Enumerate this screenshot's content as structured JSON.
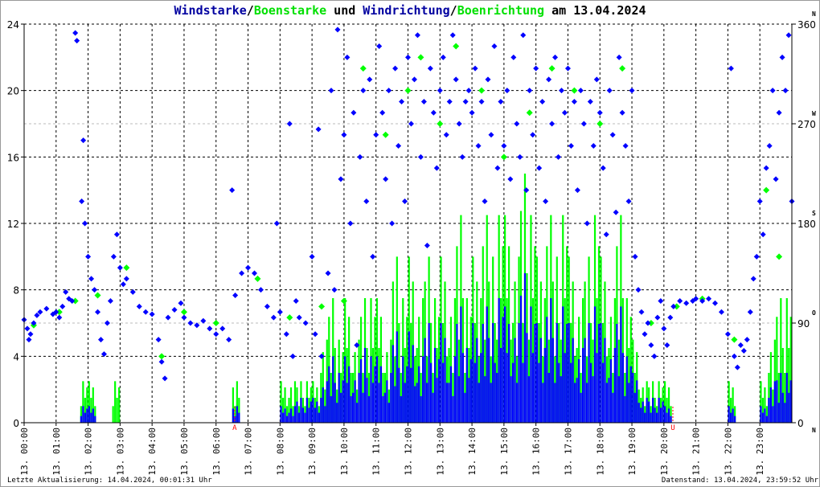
{
  "title": {
    "p1": "Windstarke",
    "s1": "/",
    "p2": "Boenstarke",
    "p3": " und ",
    "p4": "Windrichtung",
    "s2": "/",
    "p5": "Boenrichtung",
    "p6": " am 13.04.2024"
  },
  "footer": {
    "left": "Letzte Aktualisierung: 14.04.2024, 00:01:31 Uhr",
    "right": "Datenstand: 13.04.2024, 23:59:52 Uhr"
  },
  "chart_data": {
    "type": "scatter",
    "title": "Windstarke/Boenstarke und Windrichtung/Boenrichtung am 13.04.2024",
    "x_range_hours": [
      0,
      24
    ],
    "x_tick_labels": [
      "13. 00:00",
      "13. 01:00",
      "13. 02:00",
      "13. 03:00",
      "13. 04:00",
      "13. 05:00",
      "13. 06:00",
      "13. 07:00",
      "13. 08:00",
      "13. 09:00",
      "13. 10:00",
      "13. 11:00",
      "13. 12:00",
      "13. 13:00",
      "13. 14:00",
      "13. 15:00",
      "13. 16:00",
      "13. 17:00",
      "13. 18:00",
      "13. 19:00",
      "13. 20:00",
      "13. 21:00",
      "13. 22:00",
      "13. 23:00"
    ],
    "left_axis": {
      "range": [
        0,
        24
      ],
      "ticks": [
        "0",
        "4",
        "8",
        "12",
        "16",
        "20",
        "24"
      ]
    },
    "right_axis": {
      "range": [
        0,
        360
      ],
      "ticks": [
        "0",
        "90",
        "180",
        "270",
        "360"
      ],
      "compass": [
        "N",
        "O",
        "S",
        "W",
        "N"
      ]
    },
    "markers": [
      {
        "label": "A",
        "hour": 6.58
      },
      {
        "label": "U",
        "hour": 20.28
      }
    ],
    "colors": {
      "wind": "#0000ff",
      "gust": "#00ff00",
      "marker": "#ff0000"
    },
    "interval_minutes": 15,
    "gust_speed": [
      0,
      0,
      0,
      0,
      0,
      0,
      0,
      2.5,
      2.5,
      0,
      0,
      2.5,
      0,
      0,
      0,
      0,
      0,
      0,
      0,
      0,
      0,
      0,
      0,
      0,
      0,
      0,
      2.5,
      0,
      0,
      0,
      0,
      0,
      2.5,
      2.5,
      2.5,
      2.5,
      2.5,
      5,
      7.5,
      5,
      7.5,
      5,
      7.5,
      7.5,
      7.5,
      5,
      10,
      7.5,
      10,
      7.5,
      10,
      7.5,
      10,
      7.5,
      12.5,
      7.5,
      10,
      12.5,
      10,
      12.5,
      12.5,
      10,
      15,
      12.5,
      10,
      12.5,
      10,
      12.5,
      10,
      7.5,
      10,
      12.5,
      10,
      7.5,
      12.5,
      7.5,
      5,
      2.5,
      2.5,
      2.5,
      2.5,
      0,
      0,
      0,
      0,
      0,
      0,
      0,
      2.5,
      0,
      0,
      0,
      2.5,
      5,
      7.5,
      7.5
    ],
    "wind_speed": [
      0,
      0,
      0,
      0,
      0,
      0,
      0,
      1,
      1,
      0,
      0,
      0,
      0,
      0,
      0,
      0,
      0,
      0,
      0,
      0,
      0,
      0,
      0,
      0,
      0,
      0,
      1,
      0,
      0,
      0,
      0,
      0,
      1,
      1,
      1.5,
      1.5,
      1.5,
      2.5,
      4,
      3,
      4,
      3,
      4.5,
      4,
      4,
      3,
      5.5,
      4,
      5.5,
      4,
      6,
      4.5,
      6,
      4,
      7,
      4.5,
      6,
      7,
      6,
      7.5,
      7,
      6,
      9,
      7,
      6,
      7.5,
      6,
      7,
      6,
      4.5,
      6,
      7,
      6,
      4.5,
      7,
      4,
      3,
      1.5,
      1.5,
      1.5,
      1,
      0,
      0,
      0,
      0,
      0,
      0,
      0,
      1,
      0,
      0,
      0,
      1,
      2.5,
      3,
      3
    ],
    "wind_direction": [
      [
        0,
        93
      ],
      [
        0.1,
        85
      ],
      [
        0.15,
        75
      ],
      [
        0.2,
        80
      ],
      [
        0.3,
        90
      ],
      [
        0.4,
        97
      ],
      [
        0.5,
        100
      ],
      [
        0.7,
        103
      ],
      [
        0.9,
        98
      ],
      [
        1,
        100
      ],
      [
        1.1,
        95
      ],
      [
        1.2,
        105
      ],
      [
        1.3,
        118
      ],
      [
        1.4,
        112
      ],
      [
        1.5,
        110
      ],
      [
        1.6,
        352
      ],
      [
        1.65,
        345
      ],
      [
        1.8,
        200
      ],
      [
        1.85,
        255
      ],
      [
        1.9,
        180
      ],
      [
        2,
        150
      ],
      [
        2.1,
        130
      ],
      [
        2.2,
        120
      ],
      [
        2.3,
        100
      ],
      [
        2.4,
        75
      ],
      [
        2.5,
        62
      ],
      [
        2.6,
        90
      ],
      [
        2.7,
        110
      ],
      [
        2.8,
        150
      ],
      [
        2.9,
        170
      ],
      [
        3,
        140
      ],
      [
        3.1,
        125
      ],
      [
        3.2,
        130
      ],
      [
        3.4,
        118
      ],
      [
        3.6,
        105
      ],
      [
        3.8,
        100
      ],
      [
        4,
        98
      ],
      [
        4.2,
        75
      ],
      [
        4.3,
        55
      ],
      [
        4.4,
        40
      ],
      [
        4.5,
        95
      ],
      [
        4.7,
        102
      ],
      [
        4.9,
        108
      ],
      [
        5,
        95
      ],
      [
        5.2,
        90
      ],
      [
        5.4,
        88
      ],
      [
        5.6,
        92
      ],
      [
        5.8,
        85
      ],
      [
        6,
        80
      ],
      [
        6.2,
        85
      ],
      [
        6.4,
        75
      ],
      [
        6.5,
        210
      ],
      [
        6.6,
        115
      ],
      [
        6.8,
        135
      ],
      [
        7,
        140
      ],
      [
        7.2,
        135
      ],
      [
        7.4,
        120
      ],
      [
        7.6,
        105
      ],
      [
        7.8,
        95
      ],
      [
        7.9,
        180
      ],
      [
        8,
        100
      ],
      [
        8.2,
        80
      ],
      [
        8.3,
        270
      ],
      [
        8.4,
        60
      ],
      [
        8.5,
        110
      ],
      [
        8.6,
        95
      ],
      [
        8.8,
        90
      ],
      [
        9,
        150
      ],
      [
        9.1,
        80
      ],
      [
        9.2,
        265
      ],
      [
        9.3,
        60
      ],
      [
        9.5,
        135
      ],
      [
        9.6,
        300
      ],
      [
        9.7,
        120
      ],
      [
        9.8,
        355
      ],
      [
        9.9,
        220
      ],
      [
        10,
        260
      ],
      [
        10.1,
        330
      ],
      [
        10.2,
        180
      ],
      [
        10.3,
        280
      ],
      [
        10.4,
        70
      ],
      [
        10.5,
        240
      ],
      [
        10.6,
        300
      ],
      [
        10.7,
        200
      ],
      [
        10.8,
        310
      ],
      [
        10.9,
        150
      ],
      [
        11,
        260
      ],
      [
        11.1,
        340
      ],
      [
        11.2,
        280
      ],
      [
        11.3,
        220
      ],
      [
        11.4,
        300
      ],
      [
        11.5,
        180
      ],
      [
        11.6,
        320
      ],
      [
        11.7,
        250
      ],
      [
        11.8,
        290
      ],
      [
        11.9,
        200
      ],
      [
        12,
        330
      ],
      [
        12.1,
        270
      ],
      [
        12.2,
        310
      ],
      [
        12.3,
        350
      ],
      [
        12.4,
        240
      ],
      [
        12.5,
        290
      ],
      [
        12.6,
        160
      ],
      [
        12.7,
        320
      ],
      [
        12.8,
        280
      ],
      [
        12.9,
        230
      ],
      [
        13,
        300
      ],
      [
        13.1,
        330
      ],
      [
        13.2,
        260
      ],
      [
        13.3,
        290
      ],
      [
        13.4,
        350
      ],
      [
        13.5,
        310
      ],
      [
        13.6,
        270
      ],
      [
        13.7,
        240
      ],
      [
        13.8,
        290
      ],
      [
        13.9,
        300
      ],
      [
        14,
        280
      ],
      [
        14.1,
        320
      ],
      [
        14.2,
        250
      ],
      [
        14.3,
        290
      ],
      [
        14.4,
        200
      ],
      [
        14.5,
        310
      ],
      [
        14.6,
        260
      ],
      [
        14.7,
        340
      ],
      [
        14.8,
        230
      ],
      [
        14.9,
        290
      ],
      [
        15,
        250
      ],
      [
        15.1,
        300
      ],
      [
        15.2,
        220
      ],
      [
        15.3,
        330
      ],
      [
        15.4,
        270
      ],
      [
        15.5,
        240
      ],
      [
        15.6,
        350
      ],
      [
        15.7,
        210
      ],
      [
        15.8,
        300
      ],
      [
        15.9,
        260
      ],
      [
        16,
        320
      ],
      [
        16.1,
        230
      ],
      [
        16.2,
        290
      ],
      [
        16.3,
        200
      ],
      [
        16.4,
        310
      ],
      [
        16.5,
        270
      ],
      [
        16.6,
        330
      ],
      [
        16.7,
        240
      ],
      [
        16.8,
        300
      ],
      [
        16.9,
        280
      ],
      [
        17,
        320
      ],
      [
        17.1,
        250
      ],
      [
        17.2,
        290
      ],
      [
        17.3,
        210
      ],
      [
        17.4,
        300
      ],
      [
        17.5,
        270
      ],
      [
        17.6,
        180
      ],
      [
        17.7,
        290
      ],
      [
        17.8,
        250
      ],
      [
        17.9,
        310
      ],
      [
        18,
        280
      ],
      [
        18.1,
        230
      ],
      [
        18.2,
        170
      ],
      [
        18.3,
        300
      ],
      [
        18.4,
        260
      ],
      [
        18.5,
        190
      ],
      [
        18.6,
        330
      ],
      [
        18.7,
        280
      ],
      [
        18.8,
        250
      ],
      [
        18.9,
        200
      ],
      [
        19,
        300
      ],
      [
        19.1,
        150
      ],
      [
        19.2,
        120
      ],
      [
        19.3,
        100
      ],
      [
        19.4,
        80
      ],
      [
        19.5,
        90
      ],
      [
        19.6,
        70
      ],
      [
        19.7,
        60
      ],
      [
        19.8,
        95
      ],
      [
        19.9,
        110
      ],
      [
        20,
        85
      ],
      [
        20.1,
        70
      ],
      [
        20.2,
        95
      ],
      [
        20.3,
        105
      ],
      [
        20.5,
        110
      ],
      [
        20.7,
        108
      ],
      [
        20.9,
        110
      ],
      [
        21,
        112
      ],
      [
        21.2,
        110
      ],
      [
        21.4,
        112
      ],
      [
        21.6,
        108
      ],
      [
        21.8,
        100
      ],
      [
        22,
        80
      ],
      [
        22.1,
        320
      ],
      [
        22.2,
        60
      ],
      [
        22.3,
        50
      ],
      [
        22.4,
        70
      ],
      [
        22.5,
        65
      ],
      [
        22.6,
        75
      ],
      [
        22.7,
        100
      ],
      [
        22.8,
        130
      ],
      [
        22.9,
        150
      ],
      [
        23,
        200
      ],
      [
        23.1,
        170
      ],
      [
        23.2,
        230
      ],
      [
        23.3,
        250
      ],
      [
        23.4,
        300
      ],
      [
        23.5,
        220
      ],
      [
        23.6,
        280
      ],
      [
        23.7,
        330
      ],
      [
        23.8,
        300
      ],
      [
        23.9,
        350
      ],
      [
        24,
        200
      ]
    ],
    "gust_direction": [
      [
        0.3,
        88
      ],
      [
        1.1,
        100
      ],
      [
        1.6,
        110
      ],
      [
        2.3,
        115
      ],
      [
        3.2,
        140
      ],
      [
        4.3,
        60
      ],
      [
        5,
        100
      ],
      [
        6,
        90
      ],
      [
        7.3,
        130
      ],
      [
        8.3,
        95
      ],
      [
        9.3,
        105
      ],
      [
        10,
        110
      ],
      [
        10.6,
        320
      ],
      [
        11.3,
        260
      ],
      [
        12,
        300
      ],
      [
        12.4,
        330
      ],
      [
        13,
        270
      ],
      [
        13.5,
        340
      ],
      [
        14.3,
        300
      ],
      [
        15,
        240
      ],
      [
        15.8,
        280
      ],
      [
        16.5,
        320
      ],
      [
        17.2,
        300
      ],
      [
        18,
        270
      ],
      [
        18.7,
        320
      ],
      [
        19.6,
        90
      ],
      [
        20.4,
        105
      ],
      [
        21.2,
        112
      ],
      [
        22.2,
        75
      ],
      [
        23.2,
        210
      ],
      [
        23.6,
        150
      ]
    ]
  }
}
